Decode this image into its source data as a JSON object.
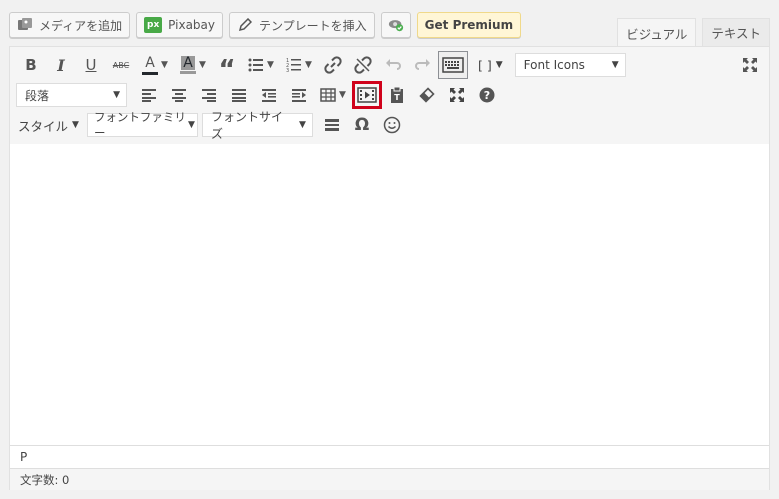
{
  "media_buttons": {
    "add_media": "メディアを追加",
    "pixabay_icon_text": "px",
    "pixabay": "Pixabay",
    "template_insert": "テンプレートを挿入",
    "get_premium": "Get Premium"
  },
  "tabs": {
    "visual": "ビジュアル",
    "text": "テキスト"
  },
  "toolbar": {
    "bold": "B",
    "italic": "I",
    "underline": "U",
    "strikethrough": "ABC",
    "text_color": "A",
    "bg_color": "A",
    "shortcode": "[ ]",
    "font_icons": "Font Icons",
    "format_select": "段落",
    "styles": "スタイル",
    "font_family": "フォントファミリー",
    "font_size": "フォントサイズ",
    "omega": "Ω"
  },
  "status": {
    "path": "P",
    "word_count": "文字数: 0"
  },
  "colors": {
    "highlight": "#d0021b",
    "pixabay_green": "#48a947",
    "premium_bg": "#fff6d6"
  }
}
